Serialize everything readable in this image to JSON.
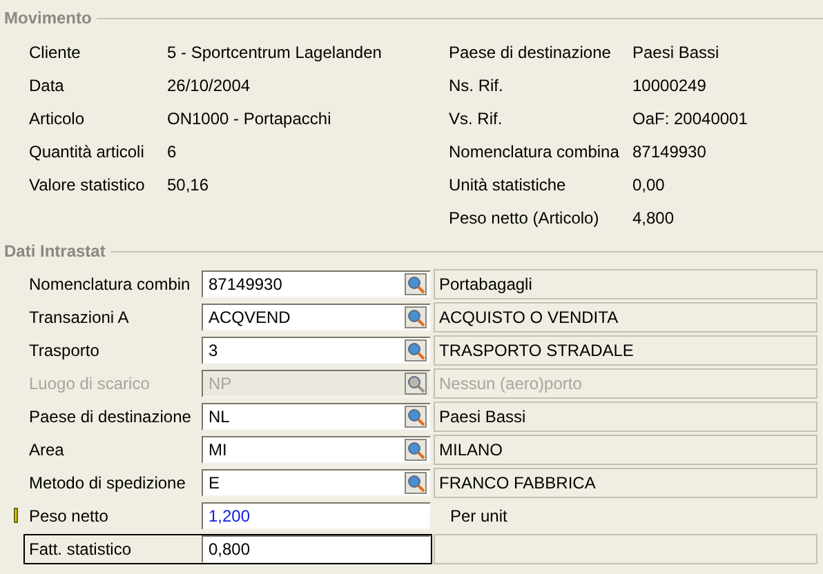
{
  "movimento": {
    "title": "Movimento",
    "left": [
      {
        "label": "Cliente",
        "value": "5 - Sportcentrum Lagelanden"
      },
      {
        "label": "Data",
        "value": "26/10/2004"
      },
      {
        "label": "Articolo",
        "value": "ON1000 - Portapacchi"
      },
      {
        "label": "Quantità articoli",
        "value": "6"
      },
      {
        "label": "Valore statistico",
        "value": "50,16"
      }
    ],
    "right": [
      {
        "label": "Paese di destinazione",
        "value": "Paesi Bassi"
      },
      {
        "label": "Ns. Rif.",
        "value": "10000249"
      },
      {
        "label": "Vs. Rif.",
        "value": "OaF: 20040001"
      },
      {
        "label": "Nomenclatura combina",
        "value": "87149930"
      },
      {
        "label": "Unità statistiche",
        "value": "0,00"
      },
      {
        "label": "Peso netto (Articolo)",
        "value": "4,800"
      }
    ]
  },
  "intrastat": {
    "title": "Dati Intrastat",
    "fields": [
      {
        "kind": "lookup",
        "label": "Nomenclatura combin",
        "value": "87149930",
        "description": "Portabagagli",
        "disabled": false,
        "modified": false,
        "flagged": false,
        "focused": false
      },
      {
        "kind": "lookup",
        "label": "Transazioni A",
        "value": "ACQVEND",
        "description": "ACQUISTO O VENDITA",
        "disabled": false,
        "modified": false,
        "flagged": false,
        "focused": false
      },
      {
        "kind": "lookup",
        "label": "Trasporto",
        "value": "3",
        "description": "TRASPORTO STRADALE",
        "disabled": false,
        "modified": false,
        "flagged": false,
        "focused": false
      },
      {
        "kind": "lookup",
        "label": "Luogo di scarico",
        "value": "NP",
        "description": "Nessun (aero)porto",
        "disabled": true,
        "modified": false,
        "flagged": false,
        "focused": false
      },
      {
        "kind": "lookup",
        "label": "Paese di destinazione",
        "value": "NL",
        "description": "Paesi Bassi",
        "disabled": false,
        "modified": false,
        "flagged": false,
        "focused": false
      },
      {
        "kind": "lookup",
        "label": "Area",
        "value": "MI",
        "description": "MILANO",
        "disabled": false,
        "modified": false,
        "flagged": false,
        "focused": false
      },
      {
        "kind": "lookup",
        "label": "Metodo di spedizione",
        "value": "E",
        "description": "FRANCO FABBRICA",
        "disabled": false,
        "modified": false,
        "flagged": false,
        "focused": false
      },
      {
        "kind": "unit",
        "label": "Peso netto",
        "value": "1,200",
        "unit": "Per unit",
        "disabled": false,
        "modified": true,
        "flagged": true,
        "focused": false
      },
      {
        "kind": "plain",
        "label": "Fatt. statistico",
        "value": "0,800",
        "disabled": false,
        "modified": false,
        "flagged": false,
        "focused": true
      }
    ]
  }
}
